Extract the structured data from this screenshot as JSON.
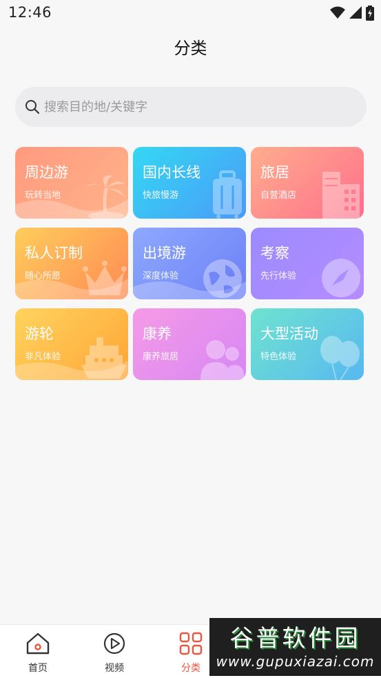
{
  "status": {
    "time": "12:46"
  },
  "header": {
    "title": "分类"
  },
  "search": {
    "placeholder": "搜索目的地/关键字"
  },
  "categories": [
    {
      "title": "周边游",
      "subtitle": "玩转当地",
      "icon": "palm-tree-icon"
    },
    {
      "title": "国内长线",
      "subtitle": "快旅慢游",
      "icon": "suitcase-icon"
    },
    {
      "title": "旅居",
      "subtitle": "自营酒店",
      "icon": "building-icon"
    },
    {
      "title": "私人订制",
      "subtitle": "随心所愿",
      "icon": "crown-icon"
    },
    {
      "title": "出境游",
      "subtitle": "深度体验",
      "icon": "globe-icon"
    },
    {
      "title": "考察",
      "subtitle": "先行体验",
      "icon": "compass-icon"
    },
    {
      "title": "游轮",
      "subtitle": "非凡体验",
      "icon": "ship-icon"
    },
    {
      "title": "康养",
      "subtitle": "康养旅居",
      "icon": "people-icon"
    },
    {
      "title": "大型活动",
      "subtitle": "特色体验",
      "icon": "balloons-icon"
    }
  ],
  "tabbar": {
    "items": [
      {
        "label": "首页",
        "icon": "home-icon"
      },
      {
        "label": "视频",
        "icon": "play-icon"
      },
      {
        "label": "分类",
        "icon": "grid-icon",
        "active": true
      }
    ],
    "active_color": "#f0543c"
  },
  "watermark": {
    "title": "谷普软件园",
    "url": "www.gupuxiazai.com"
  }
}
